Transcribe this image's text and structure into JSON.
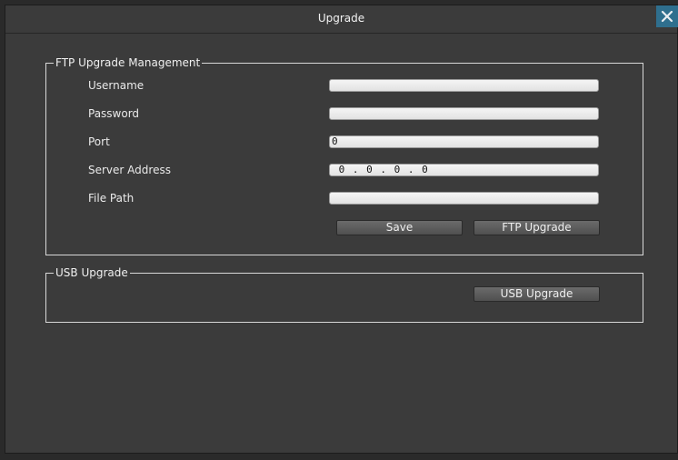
{
  "window": {
    "title": "Upgrade",
    "close_icon": "close-icon"
  },
  "ftp": {
    "legend": "FTP Upgrade Management",
    "username_label": "Username",
    "username_value": "",
    "password_label": "Password",
    "password_value": "",
    "port_label": "Port",
    "port_value": "0",
    "server_label": "Server Address",
    "server_value": " 0 . 0 . 0 . 0",
    "filepath_label": "File Path",
    "filepath_value": "",
    "save_label": "Save",
    "ftp_upgrade_label": "FTP Upgrade"
  },
  "usb": {
    "legend": "USB Upgrade",
    "usb_upgrade_label": "USB Upgrade"
  },
  "colors": {
    "accent": "#2f6f8e",
    "panel": "#3b3b3b"
  }
}
